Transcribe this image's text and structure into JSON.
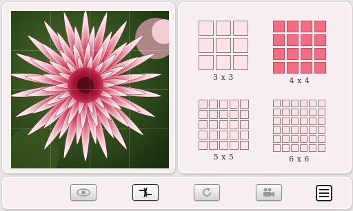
{
  "puzzle": {
    "image": "dahlia-flower-photo",
    "grid_overlay": "4 x 4"
  },
  "difficulty": {
    "selected": "4 x 4",
    "options": [
      {
        "label": "3 x 3",
        "size": 3
      },
      {
        "label": "4 x 4",
        "size": 4
      },
      {
        "label": "5 x 5",
        "size": 5
      },
      {
        "label": "6 x 6",
        "size": 6
      }
    ]
  },
  "toolbar": {
    "buttons": [
      {
        "name": "preview-button",
        "icon": "eye-icon"
      },
      {
        "name": "swap-button",
        "icon": "swap-arrows-icon"
      },
      {
        "name": "shuffle-button",
        "icon": "refresh-icon"
      },
      {
        "name": "video-button",
        "icon": "camera-icon"
      },
      {
        "name": "menu-button",
        "icon": "hamburger-menu-icon"
      }
    ]
  },
  "colors": {
    "cell_default": "#fde2e6",
    "cell_selected": "#ee6e83",
    "panel_bg": "#f6eef0"
  }
}
